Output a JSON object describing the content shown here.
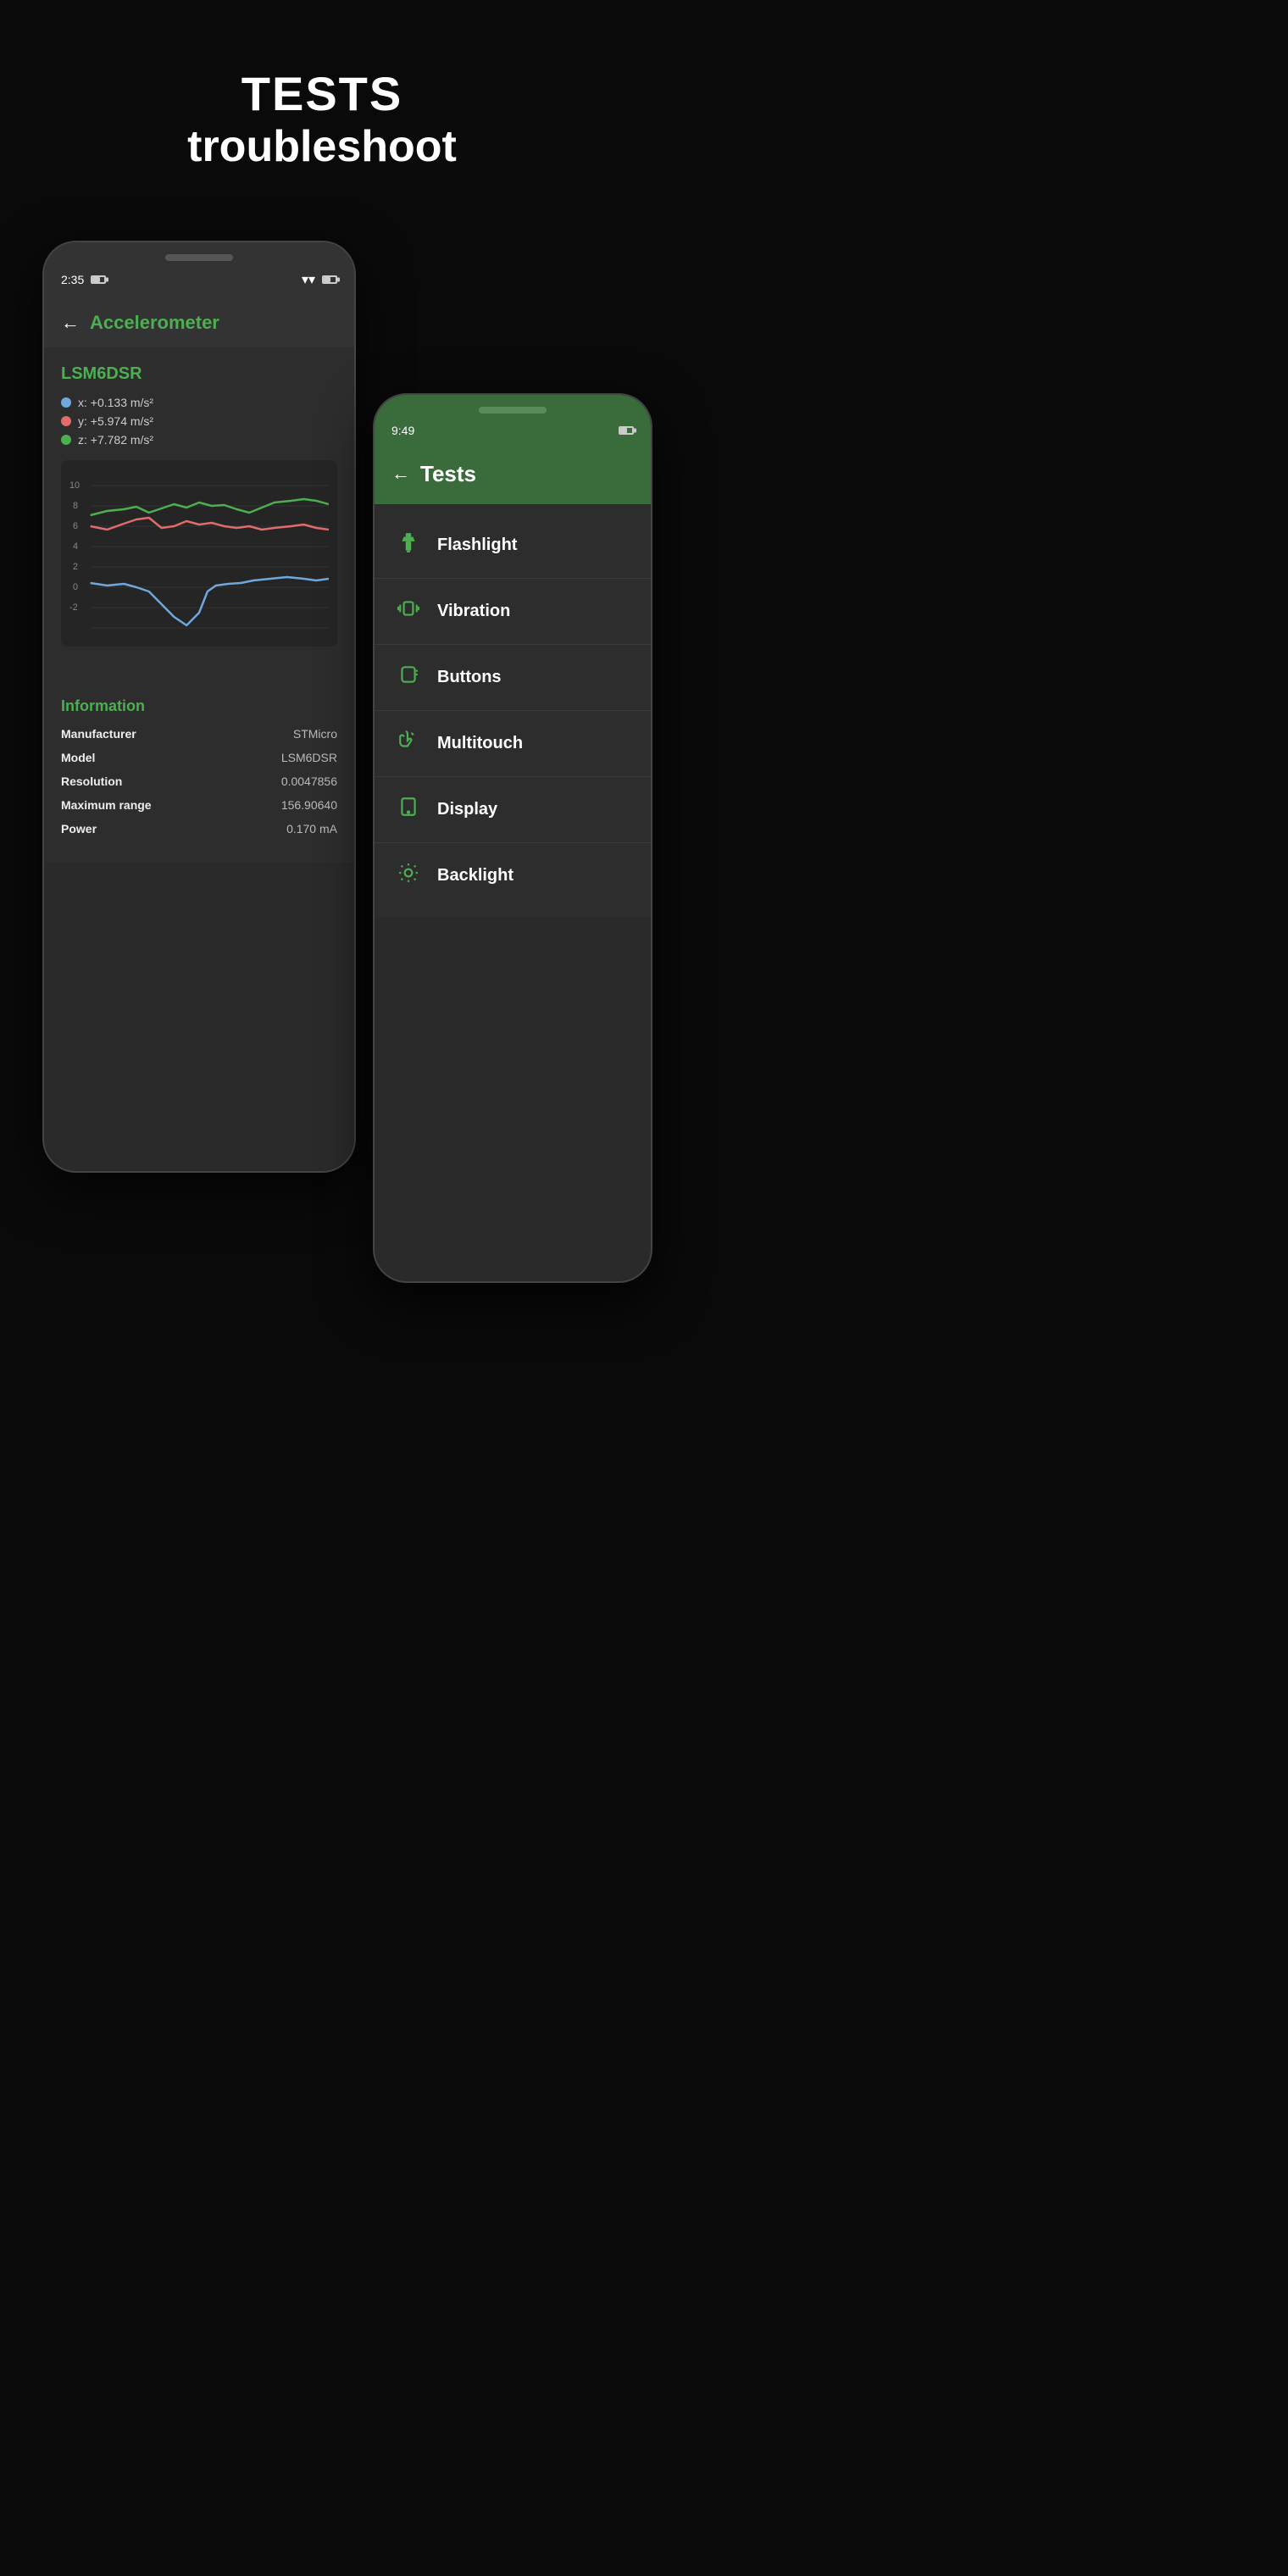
{
  "hero": {
    "title": "TESTS",
    "subtitle": "troubleshoot"
  },
  "phone_left": {
    "status": {
      "time": "2:35",
      "wifi": "wifi",
      "battery": "battery"
    },
    "header": {
      "back": "←",
      "title": "Accelerometer"
    },
    "sensor": {
      "name": "LSM6DSR",
      "x_label": "x: +0.133 m/s²",
      "y_label": "y: +5.974 m/s²",
      "z_label": "z: +7.782 m/s²"
    },
    "chart": {
      "y_labels": [
        "10",
        "8",
        "6",
        "4",
        "2",
        "0",
        "-2"
      ]
    },
    "info": {
      "title": "Information",
      "rows": [
        {
          "label": "Manufacturer",
          "value": "STMicro"
        },
        {
          "label": "Model",
          "value": "LSM6DSR"
        },
        {
          "label": "Resolution",
          "value": "0.0047856"
        },
        {
          "label": "Maximum range",
          "value": "156.90640"
        },
        {
          "label": "Power",
          "value": "0.170 mA"
        }
      ]
    }
  },
  "phone_right": {
    "status": {
      "time": "9:49",
      "battery": "battery"
    },
    "header": {
      "back": "←",
      "title": "Tests"
    },
    "tests": [
      {
        "label": "Flashlight",
        "icon": "flashlight"
      },
      {
        "label": "Vibration",
        "icon": "vibration"
      },
      {
        "label": "Buttons",
        "icon": "buttons"
      },
      {
        "label": "Multitouch",
        "icon": "multitouch"
      },
      {
        "label": "Display",
        "icon": "display"
      },
      {
        "label": "Backlight",
        "icon": "backlight"
      }
    ]
  }
}
